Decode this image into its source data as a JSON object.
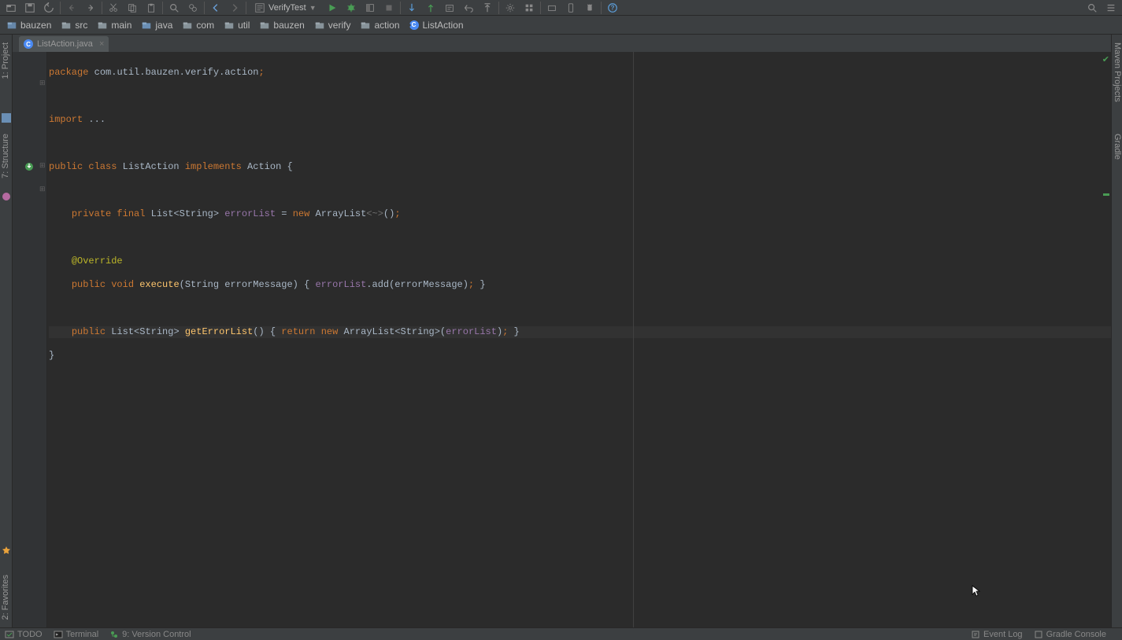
{
  "toolbar": {
    "run_config_label": "VerifyTest"
  },
  "breadcrumbs": [
    {
      "label": "bauzen",
      "type": "module"
    },
    {
      "label": "src",
      "type": "folder"
    },
    {
      "label": "main",
      "type": "folder"
    },
    {
      "label": "java",
      "type": "folder"
    },
    {
      "label": "com",
      "type": "folder"
    },
    {
      "label": "util",
      "type": "folder"
    },
    {
      "label": "bauzen",
      "type": "folder"
    },
    {
      "label": "verify",
      "type": "folder"
    },
    {
      "label": "action",
      "type": "folder"
    },
    {
      "label": "ListAction",
      "type": "class"
    }
  ],
  "side_tabs": {
    "project": "1: Project",
    "structure": "7: Structure",
    "favorites": "2: Favorites",
    "maven": "Maven Projects",
    "gradle": "Gradle"
  },
  "file_tab": {
    "label": "ListAction.java"
  },
  "code": {
    "l1_kw": "package",
    "l1_pkg": " com",
    "l1_d1": ".",
    "l1_p2": "util",
    "l1_d2": ".",
    "l1_p3": "bauzen",
    "l1_d3": ".",
    "l1_p4": "verify",
    "l1_d4": ".",
    "l1_p5": "action",
    "l1_sc": ";",
    "l3_kw": "import",
    "l3_dots": " ...",
    "l5_kw1": "public class",
    "l5_cls": " ListAction ",
    "l5_kw2": "implements",
    "l5_if": " Action ",
    "l5_br": "{",
    "l7_kw": "private final",
    "l7_type": " List<String> ",
    "l7_fld": "errorList",
    "l7_eq": " = ",
    "l7_new": "new",
    "l7_al": " ArrayList",
    "l7_gen": "<~>",
    "l7_par": "()",
    "l7_sc": ";",
    "l9_ann": "@Override",
    "l10_kw": "public void",
    "l10_m": " execute",
    "l10_p1": "(String errorMessage) ",
    "l10_br": "{",
    "l10_fld": " errorList",
    "l10_call": ".add(errorMessage)",
    "l10_sc": ";",
    "l10_cbr": " }",
    "l12_kw": "public",
    "l12_type": " List<String> ",
    "l12_m": "getErrorList",
    "l12_p": "() ",
    "l12_br": "{",
    "l12_ret": " return new",
    "l12_al": " ArrayList<String>(",
    "l12_fld": "errorList",
    "l12_end": ")",
    "l12_sc": ";",
    "l12_cbr": " }",
    "l13_br": "}"
  },
  "status": {
    "todo": "TODO",
    "terminal": "Terminal",
    "vcs": "9: Version Control",
    "event_log": "Event Log",
    "gradle_console": "Gradle Console"
  }
}
